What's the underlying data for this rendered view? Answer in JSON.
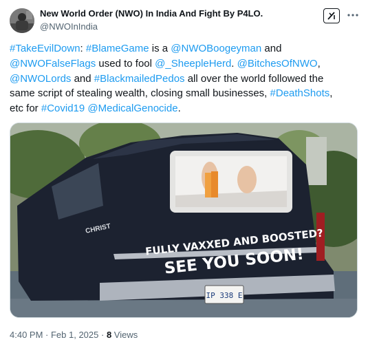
{
  "author": {
    "name": "New World Order (NWO) In India And Fight By P4LO.",
    "handle": "@NWOInIndia"
  },
  "icons": {
    "avatar": "avatar-photo",
    "grok": "grok-icon",
    "more": "more-options-icon"
  },
  "tweet": {
    "lines": [
      [
        {
          "text": "#TakeEvilDown",
          "link": true
        },
        {
          "text": ": ",
          "link": false
        },
        {
          "text": "#BlameGame",
          "link": true
        },
        {
          "text": " is a ",
          "link": false
        },
        {
          "text": "@NWOBoogeyman",
          "link": true
        },
        {
          "text": " and",
          "link": false
        }
      ],
      [
        {
          "text": "@NWOFalseFlags",
          "link": true
        },
        {
          "text": " used to fool ",
          "link": false
        },
        {
          "text": "@_SheepleHerd",
          "link": true
        },
        {
          "text": ". ",
          "link": false
        },
        {
          "text": "@BitchesOfNWO",
          "link": true
        },
        {
          "text": ",",
          "link": false
        }
      ],
      [
        {
          "text": "@NWOLords",
          "link": true
        },
        {
          "text": " and ",
          "link": false
        },
        {
          "text": "#BlackmailedPedos",
          "link": true
        },
        {
          "text": " all over the world followed the",
          "link": false
        }
      ],
      [
        {
          "text": "same script of stealing wealth, closing small businesses, ",
          "link": false
        },
        {
          "text": "#DeathShots",
          "link": true
        },
        {
          "text": ",",
          "link": false
        }
      ],
      [
        {
          "text": "etc for ",
          "link": false
        },
        {
          "text": "#Covid19",
          "link": true
        },
        {
          "text": " ",
          "link": false
        },
        {
          "text": "@MedicalGenocide",
          "link": true
        },
        {
          "text": ".",
          "link": false
        }
      ]
    ]
  },
  "media": {
    "sign_line1": "FULLY VAXXED AND BOOSTED?",
    "sign_line2": "SEE YOU SOON!",
    "license_plate": "IP 338 E",
    "side_text": "CHRIST",
    "ground_color": "#5f6e7a",
    "car_color": "#1c2230"
  },
  "meta": {
    "time": "4:40 PM",
    "sep1": " · ",
    "date": "Feb 1, 2025",
    "sep2": " · ",
    "views_count": "8",
    "views_label": " Views"
  },
  "colors": {
    "link": "#1d9bf0",
    "text": "#0f1419",
    "secondary": "#536471"
  }
}
